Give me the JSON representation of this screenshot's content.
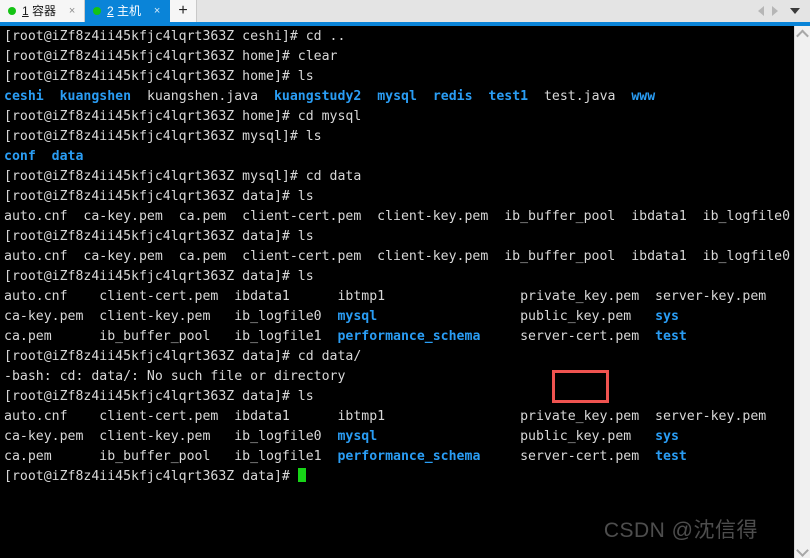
{
  "window": {
    "accent_color": "#0a84d8",
    "tabbar_bg": "#e4e4e4"
  },
  "tabs": [
    {
      "index": "1",
      "title": "容器",
      "label": "1 容器",
      "status_dot": "green",
      "close_glyph": "×",
      "active": false
    },
    {
      "index": "2",
      "title": "主机",
      "label": "2 主机",
      "status_dot": "green",
      "close_glyph": "×",
      "active": true
    }
  ],
  "tabbar_controls": {
    "add_tab_label": "+",
    "prev_icon": "triangle-left-icon",
    "next_icon": "triangle-right-icon",
    "menu_icon": "chevron-down-icon"
  },
  "terminal": {
    "background": "#000000",
    "foreground": "#d8d8d8",
    "directory_color": "#2a9df4",
    "cursor_color": "#17d417",
    "prompt_user": "root",
    "prompt_host": "iZf8z4ii45kfjc4lqrt363Z",
    "lines": [
      {
        "segs": [
          {
            "t": "[root@iZf8z4ii45kfjc4lqrt363Z ceshi]# cd ..",
            "c": "white"
          }
        ]
      },
      {
        "segs": [
          {
            "t": "[root@iZf8z4ii45kfjc4lqrt363Z home]# clear",
            "c": "white"
          }
        ]
      },
      {
        "segs": [
          {
            "t": "[root@iZf8z4ii45kfjc4lqrt363Z home]# ls",
            "c": "white"
          }
        ]
      },
      {
        "segs": [
          {
            "t": "ceshi",
            "c": "dir"
          },
          {
            "t": "  ",
            "c": "white"
          },
          {
            "t": "kuangshen",
            "c": "dir"
          },
          {
            "t": "  kuangshen.java  ",
            "c": "white"
          },
          {
            "t": "kuangstudy2",
            "c": "dir"
          },
          {
            "t": "  ",
            "c": "white"
          },
          {
            "t": "mysql",
            "c": "dir"
          },
          {
            "t": "  ",
            "c": "white"
          },
          {
            "t": "redis",
            "c": "dir"
          },
          {
            "t": "  ",
            "c": "white"
          },
          {
            "t": "test1",
            "c": "dir"
          },
          {
            "t": "  test.java  ",
            "c": "white"
          },
          {
            "t": "www",
            "c": "dir"
          }
        ]
      },
      {
        "segs": [
          {
            "t": "[root@iZf8z4ii45kfjc4lqrt363Z home]# cd mysql",
            "c": "white"
          }
        ]
      },
      {
        "segs": [
          {
            "t": "[root@iZf8z4ii45kfjc4lqrt363Z mysql]# ls",
            "c": "white"
          }
        ]
      },
      {
        "segs": [
          {
            "t": "conf",
            "c": "dir"
          },
          {
            "t": "  ",
            "c": "white"
          },
          {
            "t": "data",
            "c": "dir"
          }
        ]
      },
      {
        "segs": [
          {
            "t": "[root@iZf8z4ii45kfjc4lqrt363Z mysql]# cd data",
            "c": "white"
          }
        ]
      },
      {
        "segs": [
          {
            "t": "[root@iZf8z4ii45kfjc4lqrt363Z data]# ls",
            "c": "white"
          }
        ]
      },
      {
        "segs": [
          {
            "t": "auto.cnf  ca-key.pem  ca.pem  client-cert.pem  client-key.pem  ib_buffer_pool  ibdata1  ib_logfile0  ib_logfile",
            "c": "white"
          }
        ]
      },
      {
        "segs": [
          {
            "t": "[root@iZf8z4ii45kfjc4lqrt363Z data]# ls",
            "c": "white"
          }
        ]
      },
      {
        "segs": [
          {
            "t": "auto.cnf  ca-key.pem  ca.pem  client-cert.pem  client-key.pem  ib_buffer_pool  ibdata1  ib_logfile0  ib_logfile",
            "c": "white"
          }
        ]
      },
      {
        "segs": [
          {
            "t": "[root@iZf8z4ii45kfjc4lqrt363Z data]# ls",
            "c": "white"
          }
        ]
      },
      {
        "segs": [
          {
            "t": "auto.cnf    client-cert.pem  ibdata1      ibtmp1                 private_key.pem  server-key.pem",
            "c": "white"
          }
        ]
      },
      {
        "segs": [
          {
            "t": "ca-key.pem  client-key.pem   ib_logfile0  ",
            "c": "white"
          },
          {
            "t": "mysql",
            "c": "dir"
          },
          {
            "t": "                  public_key.pem   ",
            "c": "white"
          },
          {
            "t": "sys",
            "c": "dir"
          }
        ]
      },
      {
        "segs": [
          {
            "t": "ca.pem      ib_buffer_pool   ib_logfile1  ",
            "c": "white"
          },
          {
            "t": "performance_schema",
            "c": "dir"
          },
          {
            "t": "     server-cert.pem  ",
            "c": "white"
          },
          {
            "t": "test",
            "c": "dir"
          }
        ]
      },
      {
        "segs": [
          {
            "t": "[root@iZf8z4ii45kfjc4lqrt363Z data]# cd data/",
            "c": "white"
          }
        ]
      },
      {
        "segs": [
          {
            "t": "-bash: cd: data/: No such file or directory",
            "c": "white"
          }
        ]
      },
      {
        "segs": [
          {
            "t": "[root@iZf8z4ii45kfjc4lqrt363Z data]# ls",
            "c": "white"
          }
        ]
      },
      {
        "segs": [
          {
            "t": "auto.cnf    client-cert.pem  ibdata1      ibtmp1                 private_key.pem  server-key.pem",
            "c": "white"
          }
        ]
      },
      {
        "segs": [
          {
            "t": "ca-key.pem  client-key.pem   ib_logfile0  ",
            "c": "white"
          },
          {
            "t": "mysql",
            "c": "dir"
          },
          {
            "t": "                  public_key.pem   ",
            "c": "white"
          },
          {
            "t": "sys",
            "c": "dir"
          }
        ]
      },
      {
        "segs": [
          {
            "t": "ca.pem      ib_buffer_pool   ib_logfile1  ",
            "c": "white"
          },
          {
            "t": "performance_schema",
            "c": "dir"
          },
          {
            "t": "     server-cert.pem  ",
            "c": "white"
          },
          {
            "t": "test",
            "c": "dir"
          }
        ]
      },
      {
        "segs": [
          {
            "t": "[root@iZf8z4ii45kfjc4lqrt363Z data]# ",
            "c": "white"
          }
        ],
        "cursor": true
      }
    ]
  },
  "annotation": {
    "highlight_target": "test",
    "highlight_color": "#ef5350"
  },
  "watermark": {
    "text": "CSDN @沈信得"
  },
  "scrollbar": {
    "up_icon": "chevron-up-icon",
    "down_icon": "chevron-down-icon"
  }
}
